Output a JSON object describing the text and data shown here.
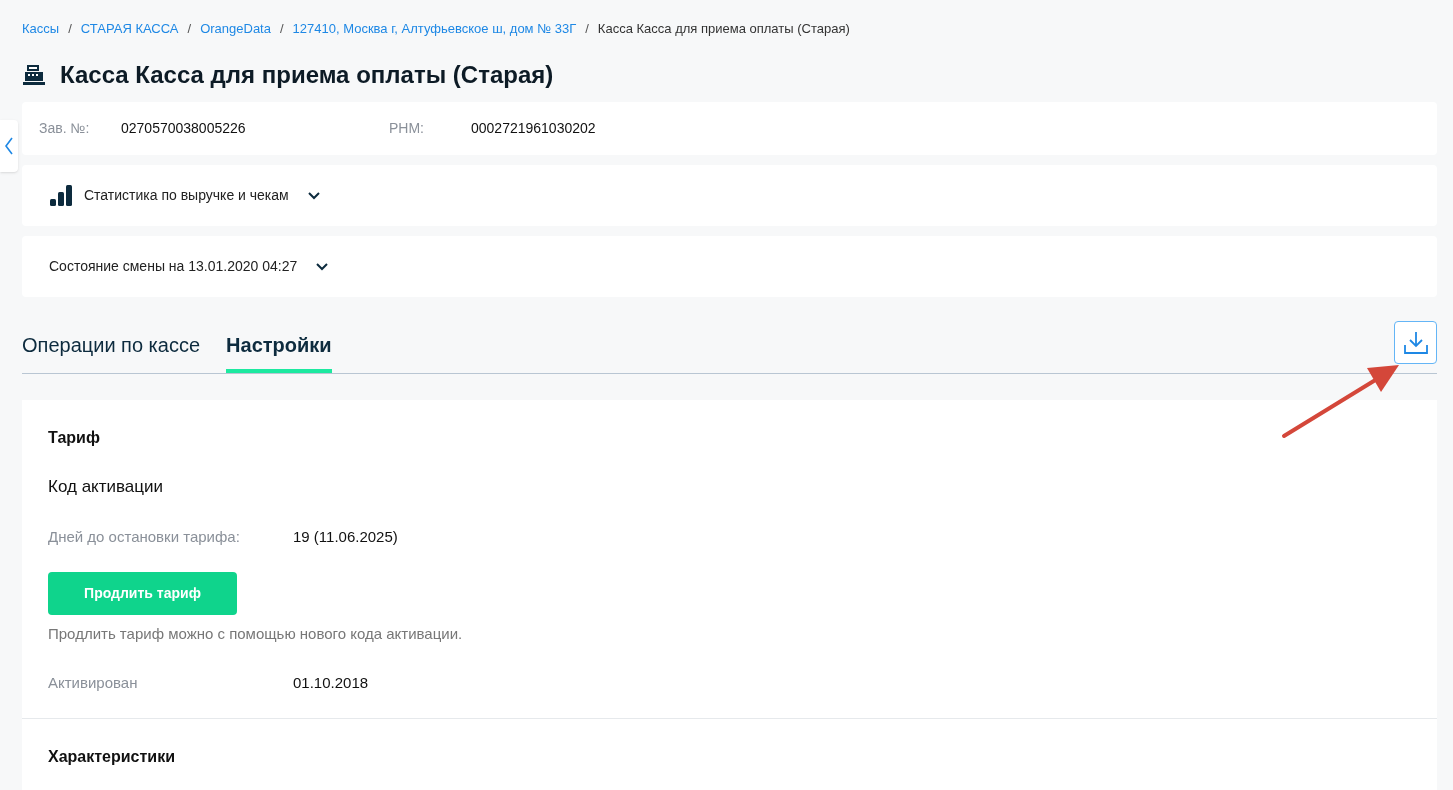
{
  "breadcrumbs": [
    {
      "kind": "link",
      "label": "Кассы"
    },
    {
      "kind": "separator",
      "label": "/"
    },
    {
      "kind": "link",
      "label": "СТАРАЯ КАССА"
    },
    {
      "kind": "separator",
      "label": "/"
    },
    {
      "kind": "link",
      "label": "OrangeData"
    },
    {
      "kind": "separator",
      "label": "/"
    },
    {
      "kind": "link",
      "label": "127410, Москва г, Алтуфьевское ш, дом № 33Г"
    },
    {
      "kind": "separator",
      "label": "/"
    },
    {
      "kind": "current",
      "label": "Касса Касса для приема оплаты (Старая)"
    }
  ],
  "title": "Касса Касса для приема оплаты (Старая)",
  "info": [
    {
      "label": "Зав. №:",
      "value": "0270570038005226"
    },
    {
      "label": "РНМ:",
      "value": "0002721961030202"
    }
  ],
  "sections": [
    {
      "kind": "stats",
      "label": "Статистика по выручке и чекам",
      "expanded": false
    },
    {
      "kind": "plain",
      "label": "Состояние смены на 13.01.2020 04:27",
      "expanded": false
    }
  ],
  "tabs": [
    {
      "label": "Операции по кассе",
      "selected": false
    },
    {
      "label": "Настройки",
      "selected": true
    }
  ],
  "tariff": {
    "heading": "Тариф",
    "subheading": "Код активации",
    "days_label": "Дней до остановки тарифа:",
    "days_value": "19 (11.06.2025)",
    "button": "Продлить тариф",
    "hint": "Продлить тариф можно с помощью нового кода активации.",
    "activated_label": "Активирован",
    "activated_value": "01.10.2018"
  },
  "characteristics": {
    "heading": "Характеристики"
  }
}
